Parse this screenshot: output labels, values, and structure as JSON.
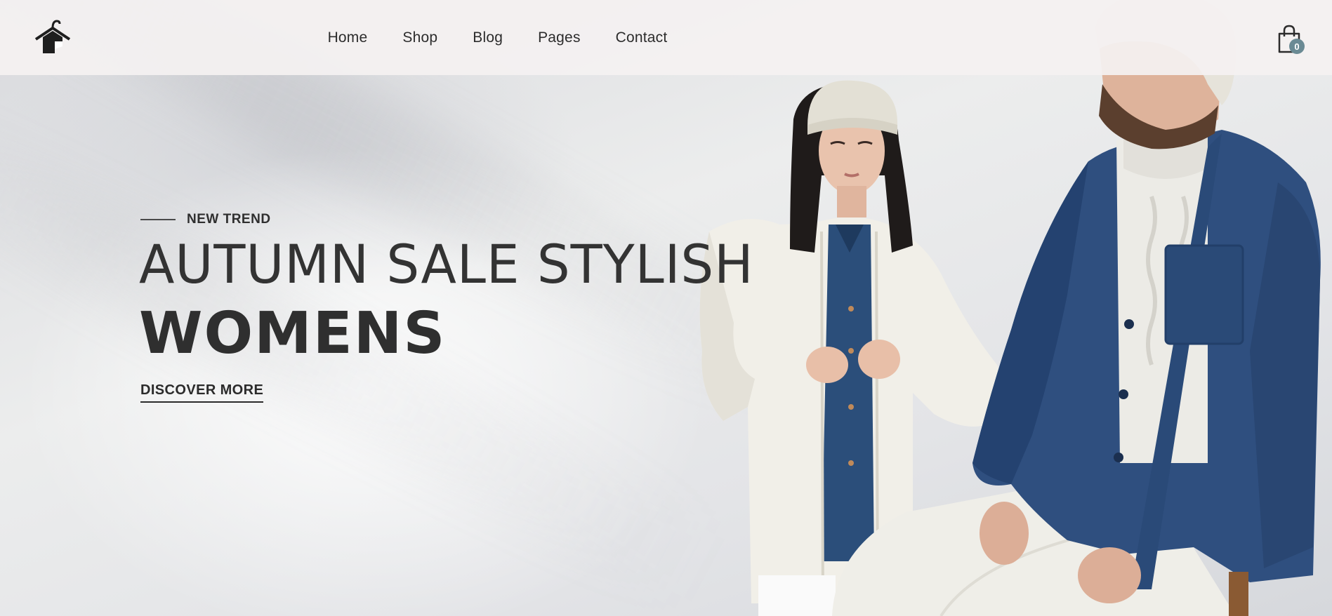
{
  "header": {
    "logo_icon": "hanger-house-icon",
    "nav": [
      {
        "label": "Home"
      },
      {
        "label": "Shop"
      },
      {
        "label": "Blog"
      },
      {
        "label": "Pages"
      },
      {
        "label": "Contact"
      }
    ],
    "cart_icon": "shopping-bag-icon",
    "cart_count": "0"
  },
  "hero": {
    "eyebrow": "NEW TREND",
    "headline_line1": "AUTUMN SALE STYLISH",
    "headline_line2": "WOMENS",
    "cta_label": "DISCOVER MORE"
  },
  "colors": {
    "text": "#2f2f2f",
    "header_bg": "#f4f1f1",
    "badge": "#6a8a94",
    "jacket_blue": "#2f4f7f",
    "coat_white": "#f2f0ea"
  }
}
